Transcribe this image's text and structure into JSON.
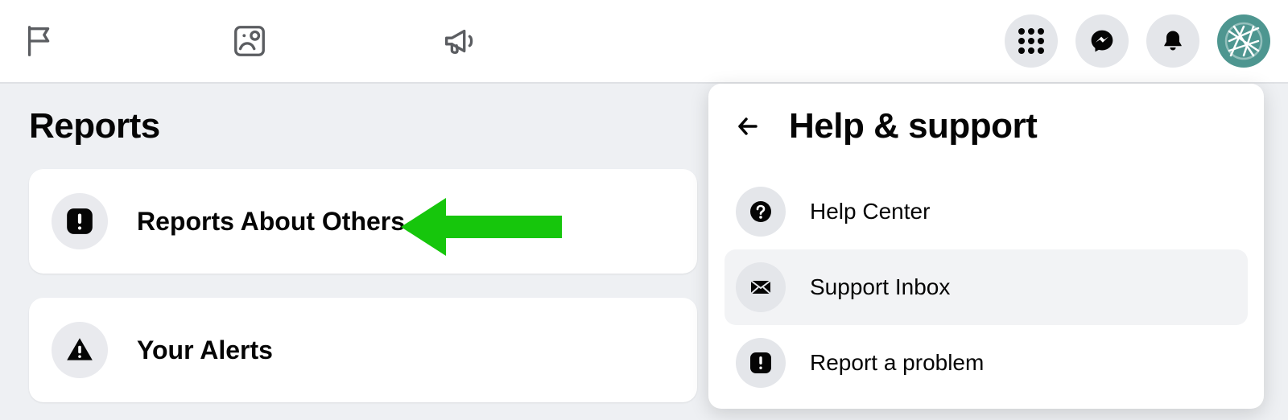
{
  "page_title": "Reports",
  "reports_items": [
    {
      "label": "Reports About Others",
      "icon": "alert-square"
    },
    {
      "label": "Your Alerts",
      "icon": "warning-triangle"
    }
  ],
  "popover": {
    "title": "Help & support",
    "items": [
      {
        "label": "Help Center",
        "icon": "help-circle",
        "selected": false
      },
      {
        "label": "Support Inbox",
        "icon": "inbox",
        "selected": true
      },
      {
        "label": "Report a problem",
        "icon": "alert-square",
        "selected": false
      }
    ]
  },
  "colors": {
    "arrow": "#16c60c",
    "avatar_bg": "#4e9690"
  }
}
